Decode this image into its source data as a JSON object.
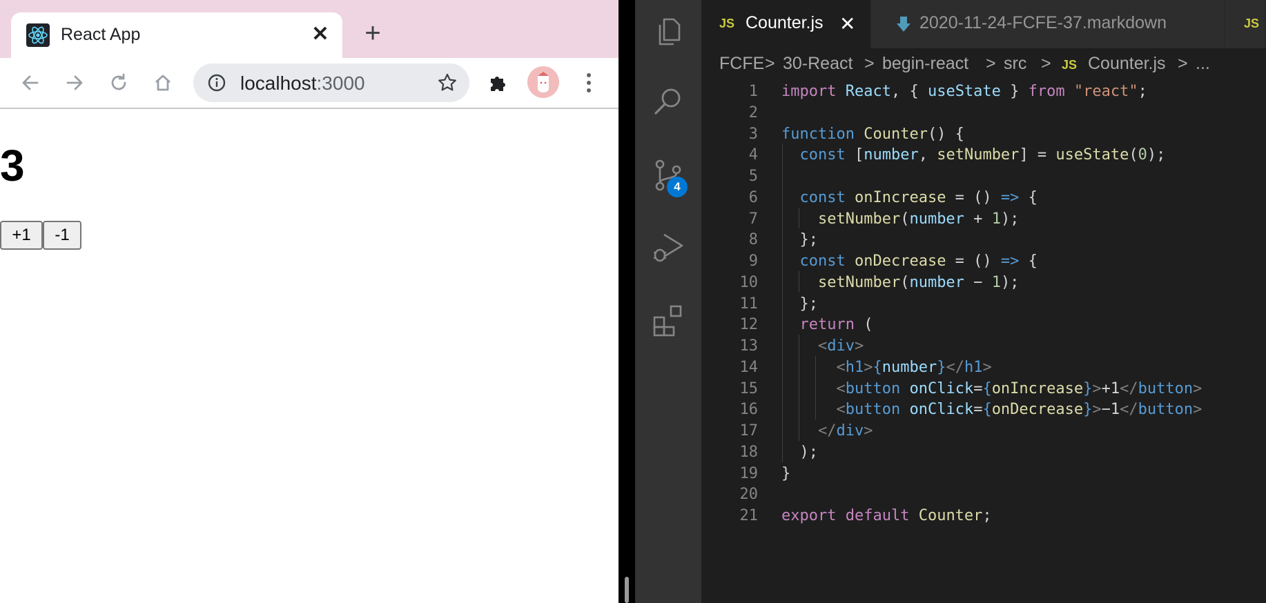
{
  "browser": {
    "tab_title": "React App",
    "close_glyph": "✕",
    "new_tab_glyph": "+",
    "url_host": "localhost",
    "url_port": ":3000",
    "page": {
      "heading": "3",
      "buttons": [
        "+1",
        "-1"
      ]
    }
  },
  "vscode": {
    "activity_badge": "4",
    "tabs": [
      {
        "icon": "JS",
        "label": "Counter.js",
        "active": true
      },
      {
        "icon": "markdown-icon",
        "label": "2020-11-24-FCFE-37.markdown",
        "active": false
      },
      {
        "icon": "JS",
        "label": "",
        "active": false
      }
    ],
    "tab_close": "✕",
    "breadcrumb": [
      "FCFE",
      "30-React",
      "begin-react",
      "src",
      "Counter.js",
      "..."
    ],
    "breadcrumb_sep": ">",
    "breadcrumb_js": "JS",
    "colors": {
      "keyword": "#c586c0",
      "declaration": "#569cd6",
      "variable": "#9cdcfe",
      "function": "#dcdcaa",
      "string": "#ce9178",
      "number": "#b5cea8",
      "badge": "#0078d4"
    },
    "code": [
      {
        "n": "1",
        "t": [
          [
            "kw",
            "import"
          ],
          [
            "p",
            " "
          ],
          [
            "var",
            "React"
          ],
          [
            "p",
            ", { "
          ],
          [
            "var",
            "useState"
          ],
          [
            "p",
            " } "
          ],
          [
            "kw",
            "from"
          ],
          [
            "p",
            " "
          ],
          [
            "str",
            "\"react\""
          ],
          [
            "p",
            ";"
          ]
        ]
      },
      {
        "n": "2",
        "t": []
      },
      {
        "n": "3",
        "t": [
          [
            "dec",
            "function"
          ],
          [
            "p",
            " "
          ],
          [
            "fn",
            "Counter"
          ],
          [
            "p",
            "() {"
          ]
        ]
      },
      {
        "n": "4",
        "t": [
          [
            "p",
            "  "
          ],
          [
            "dec",
            "const"
          ],
          [
            "p",
            " ["
          ],
          [
            "var",
            "number"
          ],
          [
            "p",
            ", "
          ],
          [
            "fn",
            "setNumber"
          ],
          [
            "p",
            "] = "
          ],
          [
            "fn",
            "useState"
          ],
          [
            "p",
            "("
          ],
          [
            "num",
            "0"
          ],
          [
            "p",
            ");"
          ]
        ]
      },
      {
        "n": "5",
        "t": []
      },
      {
        "n": "6",
        "t": [
          [
            "p",
            "  "
          ],
          [
            "dec",
            "const"
          ],
          [
            "p",
            " "
          ],
          [
            "fn",
            "onIncrease"
          ],
          [
            "p",
            " = () "
          ],
          [
            "dec",
            "=>"
          ],
          [
            "p",
            " {"
          ]
        ]
      },
      {
        "n": "7",
        "t": [
          [
            "p",
            "    "
          ],
          [
            "fn",
            "setNumber"
          ],
          [
            "p",
            "("
          ],
          [
            "var",
            "number"
          ],
          [
            "p",
            " + "
          ],
          [
            "num",
            "1"
          ],
          [
            "p",
            ");"
          ]
        ]
      },
      {
        "n": "8",
        "t": [
          [
            "p",
            "  };"
          ]
        ]
      },
      {
        "n": "9",
        "t": [
          [
            "p",
            "  "
          ],
          [
            "dec",
            "const"
          ],
          [
            "p",
            " "
          ],
          [
            "fn",
            "onDecrease"
          ],
          [
            "p",
            " = () "
          ],
          [
            "dec",
            "=>"
          ],
          [
            "p",
            " {"
          ]
        ]
      },
      {
        "n": "10",
        "t": [
          [
            "p",
            "    "
          ],
          [
            "fn",
            "setNumber"
          ],
          [
            "p",
            "("
          ],
          [
            "var",
            "number"
          ],
          [
            "p",
            " − "
          ],
          [
            "num",
            "1"
          ],
          [
            "p",
            ");"
          ]
        ]
      },
      {
        "n": "11",
        "t": [
          [
            "p",
            "  };"
          ]
        ]
      },
      {
        "n": "12",
        "t": [
          [
            "p",
            "  "
          ],
          [
            "kw",
            "return"
          ],
          [
            "p",
            " ("
          ]
        ]
      },
      {
        "n": "13",
        "t": [
          [
            "p",
            "    "
          ],
          [
            "br",
            "<"
          ],
          [
            "tag",
            "div"
          ],
          [
            "br",
            ">"
          ]
        ]
      },
      {
        "n": "14",
        "t": [
          [
            "p",
            "      "
          ],
          [
            "br",
            "<"
          ],
          [
            "tag",
            "h1"
          ],
          [
            "br",
            ">"
          ],
          [
            "jsx",
            "{"
          ],
          [
            "var",
            "number"
          ],
          [
            "jsx",
            "}"
          ],
          [
            "br",
            "</"
          ],
          [
            "tag",
            "h1"
          ],
          [
            "br",
            ">"
          ]
        ]
      },
      {
        "n": "15",
        "t": [
          [
            "p",
            "      "
          ],
          [
            "br",
            "<"
          ],
          [
            "tag",
            "button"
          ],
          [
            "p",
            " "
          ],
          [
            "var",
            "onClick"
          ],
          [
            "p",
            "="
          ],
          [
            "jsx",
            "{"
          ],
          [
            "fn",
            "onIncrease"
          ],
          [
            "jsx",
            "}"
          ],
          [
            "br",
            ">"
          ],
          [
            "p",
            "+1"
          ],
          [
            "br",
            "</"
          ],
          [
            "tag",
            "button"
          ],
          [
            "br",
            ">"
          ]
        ]
      },
      {
        "n": "16",
        "t": [
          [
            "p",
            "      "
          ],
          [
            "br",
            "<"
          ],
          [
            "tag",
            "button"
          ],
          [
            "p",
            " "
          ],
          [
            "var",
            "onClick"
          ],
          [
            "p",
            "="
          ],
          [
            "jsx",
            "{"
          ],
          [
            "fn",
            "onDecrease"
          ],
          [
            "jsx",
            "}"
          ],
          [
            "br",
            ">"
          ],
          [
            "p",
            "−1"
          ],
          [
            "br",
            "</"
          ],
          [
            "tag",
            "button"
          ],
          [
            "br",
            ">"
          ]
        ]
      },
      {
        "n": "17",
        "t": [
          [
            "p",
            "    "
          ],
          [
            "br",
            "</"
          ],
          [
            "tag",
            "div"
          ],
          [
            "br",
            ">"
          ]
        ]
      },
      {
        "n": "18",
        "t": [
          [
            "p",
            "  );"
          ]
        ]
      },
      {
        "n": "19",
        "t": [
          [
            "p",
            "}"
          ]
        ]
      },
      {
        "n": "20",
        "t": []
      },
      {
        "n": "21",
        "t": [
          [
            "kw",
            "export"
          ],
          [
            "p",
            " "
          ],
          [
            "kw",
            "default"
          ],
          [
            "p",
            " "
          ],
          [
            "fn",
            "Counter"
          ],
          [
            "p",
            ";"
          ]
        ]
      }
    ]
  }
}
